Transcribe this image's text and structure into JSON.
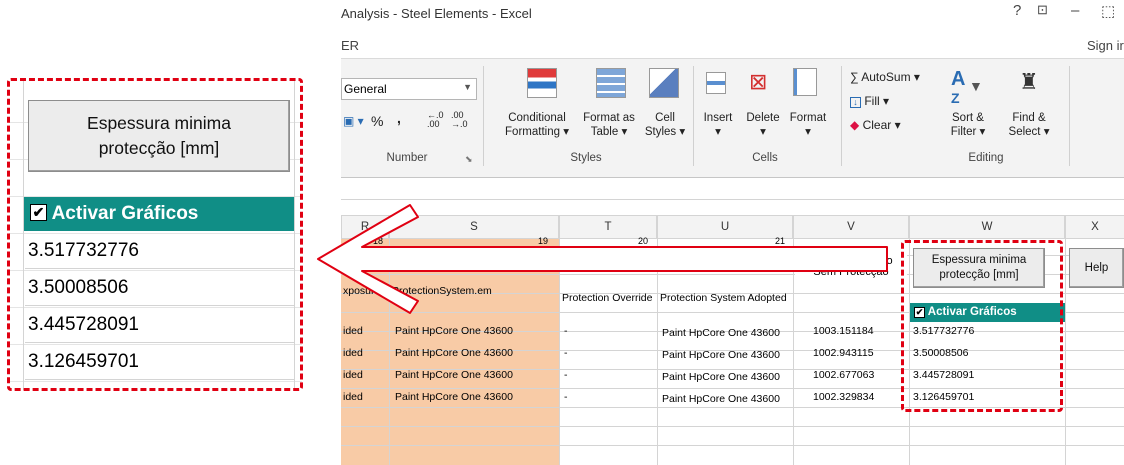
{
  "window": {
    "title": "Analysis - Steel Elements - Excel",
    "help_glyph": "?",
    "restore_glyph": "⊡",
    "minimize_glyph": "–",
    "maximize_glyph": "⬚",
    "ribbon_tab_partial": "ER",
    "sign_in": "Sign ir"
  },
  "ribbon": {
    "number": {
      "format_value": "General",
      "currency_glyph": "💲",
      "percent_glyph": "%",
      "comma_glyph": "⁹",
      "increase_decimal": ".00 →.0",
      "decrease_decimal": ".00",
      "group_label": "Number"
    },
    "styles": {
      "conditional_formatting": [
        "Conditional",
        "Formatting ▾"
      ],
      "format_as_table": [
        "Format as",
        "Table ▾"
      ],
      "cell_styles": [
        "Cell",
        "Styles ▾"
      ],
      "group_label": "Styles"
    },
    "cells": {
      "insert": "Insert",
      "delete": "Delete",
      "format": "Format",
      "caret": "▾",
      "group_label": "Cells"
    },
    "editing": {
      "autosum": "∑ AutoSum ▾",
      "fill": "Fill ▾",
      "clear": "Clear ▾",
      "sort_filter": [
        "Sort &",
        "Filter ▾"
      ],
      "find_select": [
        "Find &",
        "Select ▾"
      ],
      "group_label": "Editing"
    }
  },
  "grid": {
    "columns": [
      "R",
      "S",
      "T",
      "U",
      "V",
      "W",
      "X"
    ],
    "header_numbers": [
      "18",
      "19",
      "20",
      "21"
    ],
    "row_dash": "-",
    "header_row": {
      "r": "xposure",
      "s": "ProtectionSystem.em",
      "t": "Protection Override",
      "u": "Protection System Adopted",
      "v": [
        "Temperatura Aço",
        "Sem Protecção"
      ]
    },
    "rows": [
      {
        "r": "ided",
        "s": "Paint HpCore One 43600",
        "t": "-",
        "u": "Paint HpCore One 43600",
        "v": "1003.151184",
        "w": "3.517732776"
      },
      {
        "r": "ided",
        "s": "Paint HpCore One 43600",
        "t": "-",
        "u": "Paint HpCore One 43600",
        "v": "1002.943115",
        "w": "3.50008506"
      },
      {
        "r": "ided",
        "s": "Paint HpCore One 43600",
        "t": "-",
        "u": "Paint HpCore One 43600",
        "v": "1002.677063",
        "w": "3.445728091"
      },
      {
        "r": "ided",
        "s": "Paint HpCore One 43600",
        "t": "-",
        "u": "Paint HpCore One 43600",
        "v": "1002.329834",
        "w": "3.126459701"
      }
    ],
    "espessura_button": [
      "Espessura minima",
      "protecção [mm]"
    ],
    "help_button": "Help",
    "activar_checkbox": {
      "label": "Activar Gráficos",
      "checked_glyph": "✔"
    }
  },
  "zoom": {
    "espessura_button": [
      "Espessura minima",
      "protecção [mm]"
    ],
    "activar_label": "Activar Gráficos",
    "checked_glyph": "✔",
    "values": [
      "3.517732776",
      "3.50008506",
      "3.445728091",
      "3.126459701"
    ]
  },
  "colors": {
    "highlight_dash": "#e00012",
    "teal_header": "#108e86",
    "orange_fill": "#f8cba6",
    "arrow_stroke": "#e00012"
  }
}
